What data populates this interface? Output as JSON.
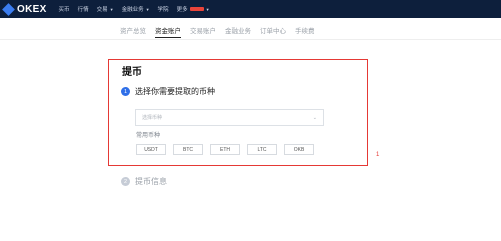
{
  "brand": {
    "logo_text": "OKEX",
    "accent": "#3b7df0",
    "topbar_bg": "#0d1f3c"
  },
  "nav": {
    "items": [
      {
        "label": "买币",
        "has_dropdown": false
      },
      {
        "label": "行情",
        "has_dropdown": false
      },
      {
        "label": "交易",
        "has_dropdown": true
      },
      {
        "label": "金融业务",
        "has_dropdown": true
      },
      {
        "label": "学院",
        "has_dropdown": false
      },
      {
        "label": "更多",
        "has_dropdown": true,
        "badge_color": "#e8443a"
      }
    ]
  },
  "subtabs": [
    {
      "label": "资产总览",
      "active": false
    },
    {
      "label": "资金账户",
      "active": true
    },
    {
      "label": "交易账户",
      "active": false
    },
    {
      "label": "金融业务",
      "active": false
    },
    {
      "label": "订单中心",
      "active": false
    },
    {
      "label": "手续费",
      "active": false
    }
  ],
  "page": {
    "title": "提币",
    "step1": {
      "number": "1",
      "label": "选择你需要提取的币种"
    },
    "select": {
      "placeholder": "选择币种",
      "chevron_icon": "chevron-down-icon"
    },
    "common_label": "常用币种",
    "coins": [
      "USDT",
      "BTC",
      "ETH",
      "LTC",
      "OKB"
    ],
    "step2": {
      "number": "2",
      "label": "提币信息"
    }
  },
  "annotation": {
    "count": "1",
    "color": "#e53935"
  }
}
